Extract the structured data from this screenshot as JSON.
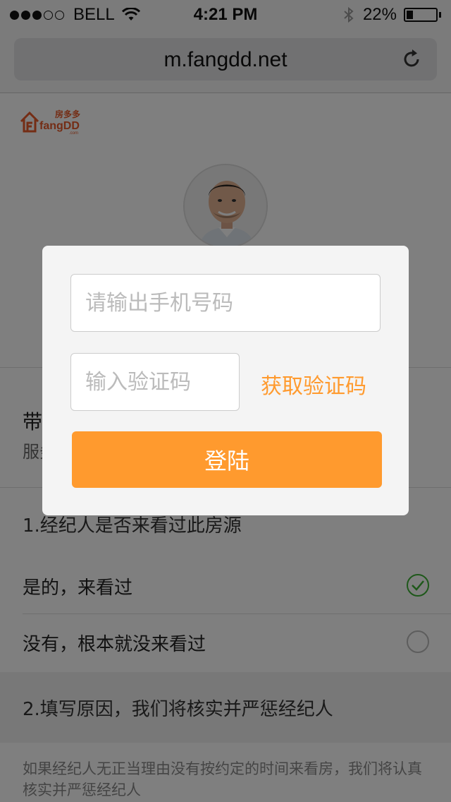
{
  "status_bar": {
    "carrier": "BELL",
    "time": "4:21 PM",
    "battery": "22%",
    "battery_level": 0.22
  },
  "browser": {
    "url": "m.fangdd.net",
    "reload_icon": "reload-icon"
  },
  "logo": {
    "cn_text": "房多多",
    "en_text": "fangDD",
    "com_text": ".com",
    "brand_color": "#e85a2a"
  },
  "service": {
    "title": "带",
    "subtitle": "服务"
  },
  "survey": {
    "q1": "1.经纪人是否来看过此房源",
    "options": [
      {
        "label": "是的，来看过",
        "checked": true
      },
      {
        "label": "没有，根本就没来看过",
        "checked": false
      }
    ],
    "q2": "2.填写原因，我们将核实并严惩经纪人",
    "note": "如果经纪人无正当理由没有按约定的时间来看房，我们将认真核实并严惩经纪人"
  },
  "login_modal": {
    "phone_placeholder": "请输出手机号码",
    "code_placeholder": "输入验证码",
    "get_code_label": "获取验证码",
    "login_label": "登陆",
    "accent_color": "#ff9a2e"
  },
  "colors": {
    "check_green": "#3cb034"
  }
}
